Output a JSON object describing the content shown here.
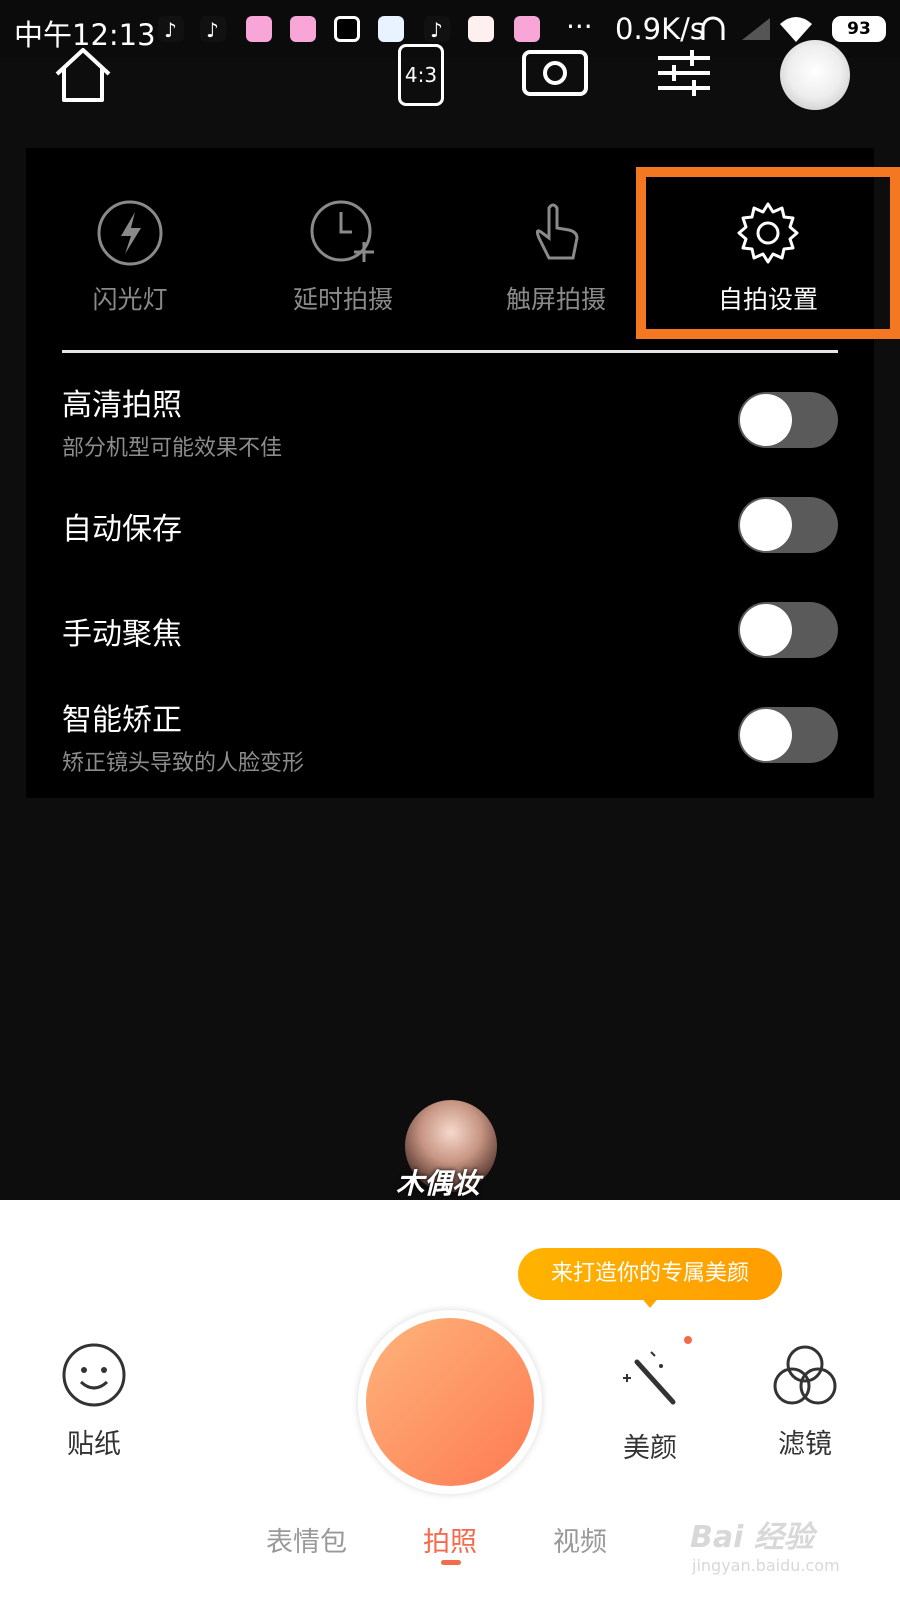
{
  "status_bar": {
    "time": "中午12:13",
    "net_speed": "0.9K/s",
    "battery": "93"
  },
  "toolbar": {
    "ratio_label": "4:3"
  },
  "settings_top": [
    {
      "label": "闪光灯",
      "icon": "flash-icon",
      "active": false
    },
    {
      "label": "延时拍摄",
      "icon": "timer-icon",
      "active": false
    },
    {
      "label": "触屏拍摄",
      "icon": "touch-icon",
      "active": false
    },
    {
      "label": "自拍设置",
      "icon": "gear-icon",
      "active": true
    }
  ],
  "settings_rows": [
    {
      "title": "高清拍照",
      "subtitle": "部分机型可能效果不佳",
      "on": false
    },
    {
      "title": "自动保存",
      "subtitle": "",
      "on": false
    },
    {
      "title": "手动聚焦",
      "subtitle": "",
      "on": false
    },
    {
      "title": "智能矫正",
      "subtitle": "矫正镜头导致的人脸变形",
      "on": false
    }
  ],
  "avatar_label": "木偶妆",
  "tooltip": "来打造你的专属美颜",
  "bottom_tools": {
    "sticker": "贴纸",
    "beauty": "美颜",
    "filter": "滤镜"
  },
  "modes": [
    {
      "label": "表情包",
      "active": false
    },
    {
      "label": "拍照",
      "active": true
    },
    {
      "label": "视频",
      "active": false
    }
  ],
  "watermark": {
    "main": "Bai 经验",
    "sub": "jingyan.baidu.com"
  },
  "colors": {
    "accent": "#f46b4c",
    "highlight": "#f47721",
    "tooltip": "#ffa500"
  }
}
